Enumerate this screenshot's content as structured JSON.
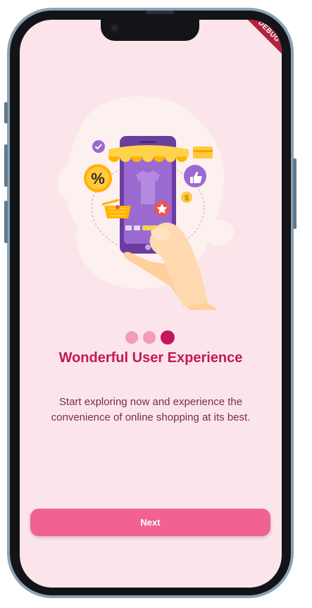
{
  "debug_banner": "DEBUG",
  "onboarding": {
    "title": "Wonderful User Experience",
    "description": "Start exploring now and experience the convenience of online shopping at its best.",
    "page_indicator": {
      "total": 3,
      "current": 3
    },
    "illustration_text": {
      "percent": "%",
      "dollar": "$"
    }
  },
  "actions": {
    "next_label": "Next"
  },
  "colors": {
    "background": "#fbe5ea",
    "accent": "#c2185b",
    "button": "#f06292",
    "dot_inactive": "#f29bbb"
  }
}
